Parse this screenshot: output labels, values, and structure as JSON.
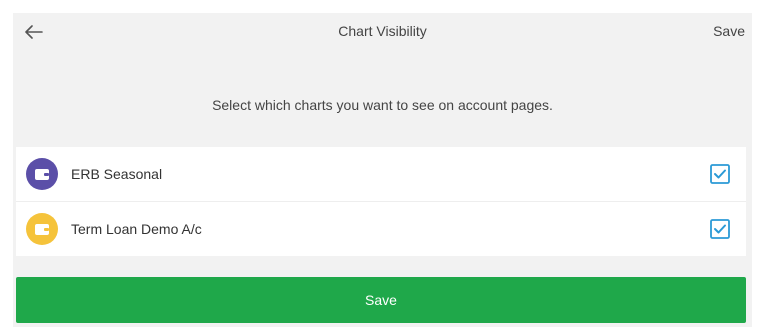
{
  "header": {
    "back_icon": "arrow-left-icon",
    "title": "Chart Visibility",
    "save_label": "Save"
  },
  "instructions": "Select which charts you want to see on account pages.",
  "accounts": [
    {
      "name": "ERB Seasonal",
      "icon": "wallet-icon",
      "icon_color": "#5b4fa8",
      "checked": true
    },
    {
      "name": "Term Loan Demo A/c",
      "icon": "wallet-icon",
      "icon_color": "#f5c33b",
      "checked": true
    }
  ],
  "save_button": {
    "label": "Save"
  },
  "colors": {
    "background": "#f2f2f2",
    "card": "#ffffff",
    "checkbox": "#2b9ad6",
    "save_button": "#1fa84a",
    "text": "#444444"
  }
}
